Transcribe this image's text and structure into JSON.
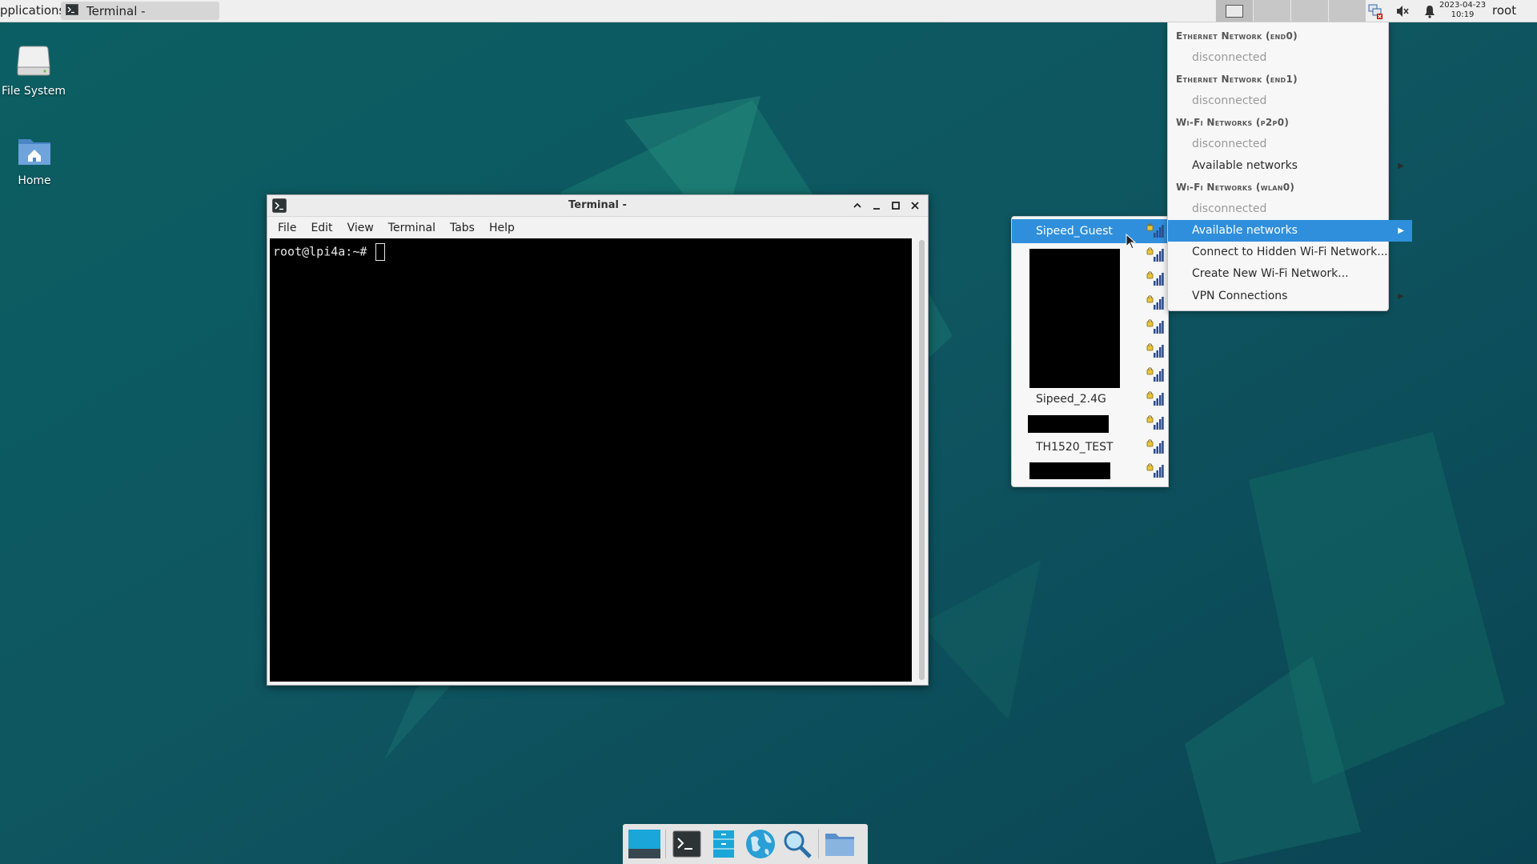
{
  "colors": {
    "desktop_bg": "#0f4f59",
    "selection": "#2f8fdc",
    "panel_bg": "#efefef",
    "terminal_bg": "#000000"
  },
  "top_panel": {
    "applications_label": "pplications",
    "task_button_label": "Terminal -",
    "clock_date": "2023-04-23",
    "clock_time": "10:19",
    "user": "root",
    "tray_icons": [
      "network-disconnected-icon",
      "volume-muted-icon",
      "bell-icon"
    ]
  },
  "desktop": {
    "icons": [
      {
        "label": "File System",
        "icon": "drive-icon"
      },
      {
        "label": "Home",
        "icon": "home-folder-icon"
      }
    ]
  },
  "terminal": {
    "title": "Terminal -",
    "menu": [
      "File",
      "Edit",
      "View",
      "Terminal",
      "Tabs",
      "Help"
    ],
    "prompt": "root@lpi4a:~# "
  },
  "network_menu": {
    "sections": [
      {
        "header": "Ethernet Network (end0)",
        "status": "disconnected"
      },
      {
        "header": "Ethernet Network (end1)",
        "status": "disconnected"
      },
      {
        "header": "Wi-Fi Networks (p2p0)",
        "status": "disconnected",
        "submenu": "Available networks"
      },
      {
        "header": "Wi-Fi Networks (wlan0)",
        "status": "disconnected",
        "submenu": "Available networks"
      }
    ],
    "actions": [
      "Connect to Hidden Wi-Fi Network...",
      "Create New Wi-Fi Network...",
      "VPN Connections"
    ]
  },
  "wifi_list": {
    "networks": [
      "Sipeed_Guest",
      "",
      "",
      "",
      "",
      "",
      "",
      "Sipeed_2.4G",
      "",
      "TH1520_TEST",
      ""
    ],
    "selected_index": 0
  },
  "dock": {
    "items": [
      "show-desktop-icon",
      "terminal-icon",
      "file-manager-icon",
      "web-browser-icon",
      "app-finder-icon",
      "folder-icon"
    ]
  }
}
